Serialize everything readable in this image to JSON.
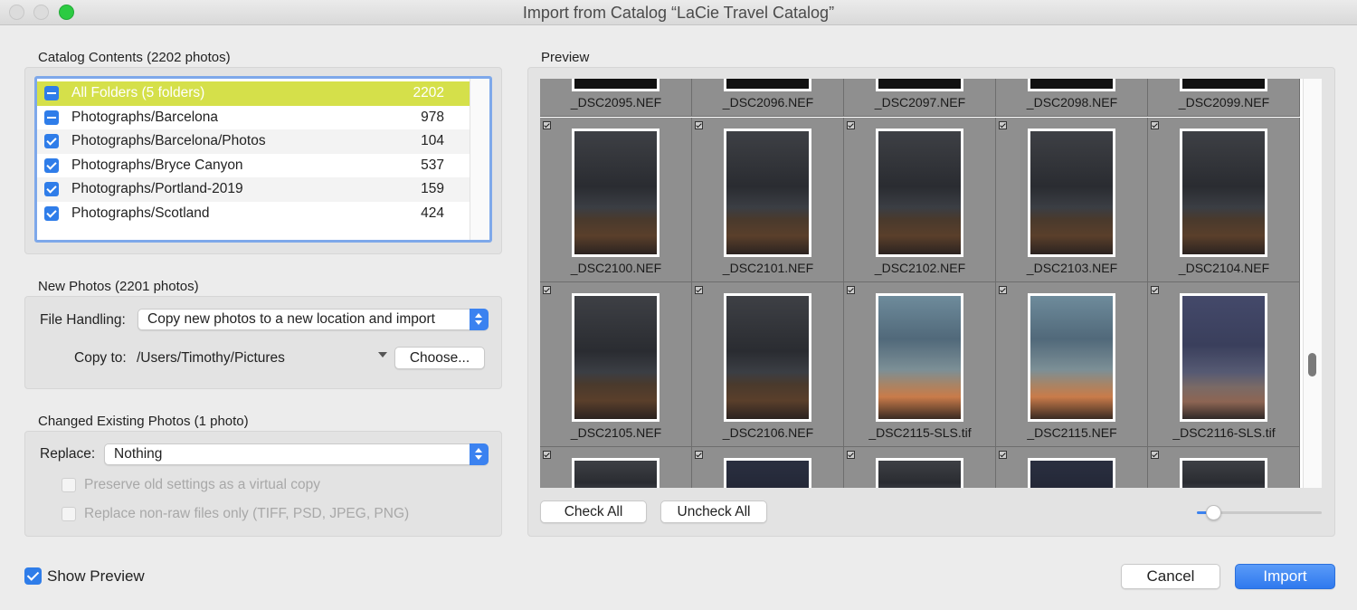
{
  "window": {
    "title": "Import from Catalog “LaCie Travel Catalog”"
  },
  "catalog": {
    "label": "Catalog Contents (2202 photos)",
    "rows": [
      {
        "state": "minus",
        "name": "All Folders (5 folders)",
        "count": "2202",
        "selected": true
      },
      {
        "state": "minus",
        "name": "Photographs/Barcelona",
        "count": "978"
      },
      {
        "state": "check",
        "name": "Photographs/Barcelona/Photos",
        "count": "104"
      },
      {
        "state": "check",
        "name": "Photographs/Bryce Canyon",
        "count": "537"
      },
      {
        "state": "check",
        "name": "Photographs/Portland-2019",
        "count": "159"
      },
      {
        "state": "check",
        "name": "Photographs/Scotland",
        "count": "424"
      }
    ]
  },
  "new_photos": {
    "label": "New Photos (2201 photos)",
    "file_handling_label": "File Handling:",
    "file_handling_value": "Copy new photos to a new location and import",
    "copy_to_label": "Copy to:",
    "copy_to_path": "/Users/Timothy/Pictures",
    "choose_button": "Choose..."
  },
  "changed": {
    "label": "Changed Existing Photos (1 photo)",
    "replace_label": "Replace:",
    "replace_value": "Nothing",
    "preserve_option": "Preserve old settings as a virtual copy",
    "nonraw_option": "Replace non-raw files only (TIFF, PSD, JPEG, PNG)"
  },
  "preview": {
    "label": "Preview",
    "check_all": "Check All",
    "uncheck_all": "Uncheck All",
    "thumbnail_size": 0.12,
    "rows": [
      [
        "_DSC2095.NEF",
        "_DSC2096.NEF",
        "_DSC2097.NEF",
        "_DSC2098.NEF",
        "_DSC2099.NEF"
      ],
      [
        "_DSC2100.NEF",
        "_DSC2101.NEF",
        "_DSC2102.NEF",
        "_DSC2103.NEF",
        "_DSC2104.NEF"
      ],
      [
        "_DSC2105.NEF",
        "_DSC2106.NEF",
        "_DSC2115-SLS.tif",
        "_DSC2115.NEF",
        "_DSC2116-SLS.tif"
      ]
    ]
  },
  "footer": {
    "show_preview": "Show Preview",
    "cancel": "Cancel",
    "import": "Import"
  },
  "colors": {
    "accent": "#2f7de9",
    "selection": "#d5e04a"
  }
}
